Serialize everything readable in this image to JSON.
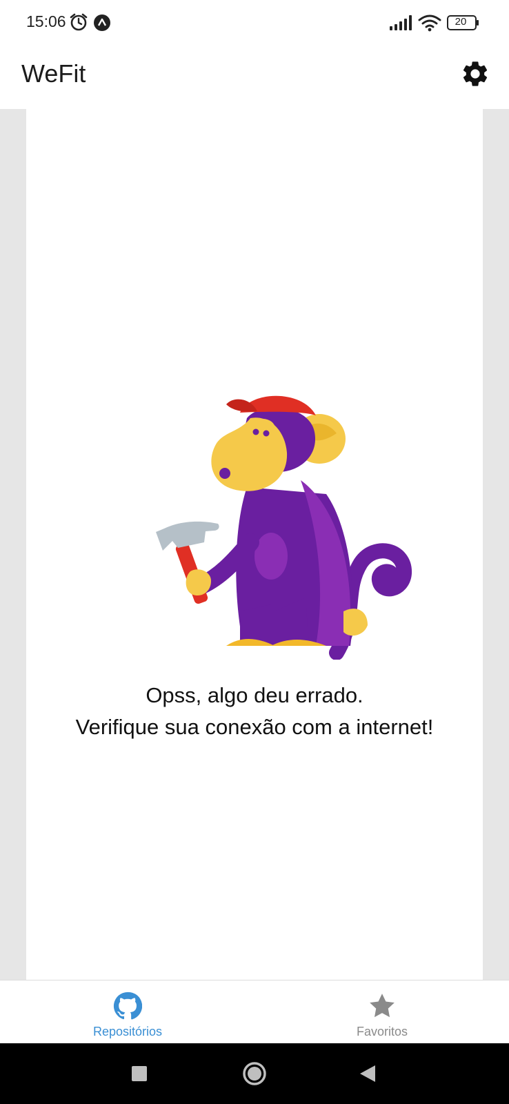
{
  "status_bar": {
    "time": "15:06",
    "battery": "20",
    "icons": [
      "alarm-icon",
      "notification-app-icon",
      "signal-icon",
      "wifi-icon",
      "battery-icon"
    ]
  },
  "app_bar": {
    "title": "WeFit",
    "settings_icon": "gear-icon"
  },
  "content": {
    "illustration": "monkey-with-hammer-illustration",
    "message_line1": "Opss, algo deu errado.",
    "message_line2": "Verifique sua conexão com a internet!"
  },
  "bottom_nav": {
    "tabs": [
      {
        "label": "Repositórios",
        "icon": "github-icon",
        "active": true
      },
      {
        "label": "Favoritos",
        "icon": "star-icon",
        "active": false
      }
    ],
    "active_color": "#3a8fd4",
    "inactive_color": "#8a8a8a"
  },
  "system_nav": {
    "buttons": [
      "recents-button",
      "home-button",
      "back-button"
    ]
  }
}
